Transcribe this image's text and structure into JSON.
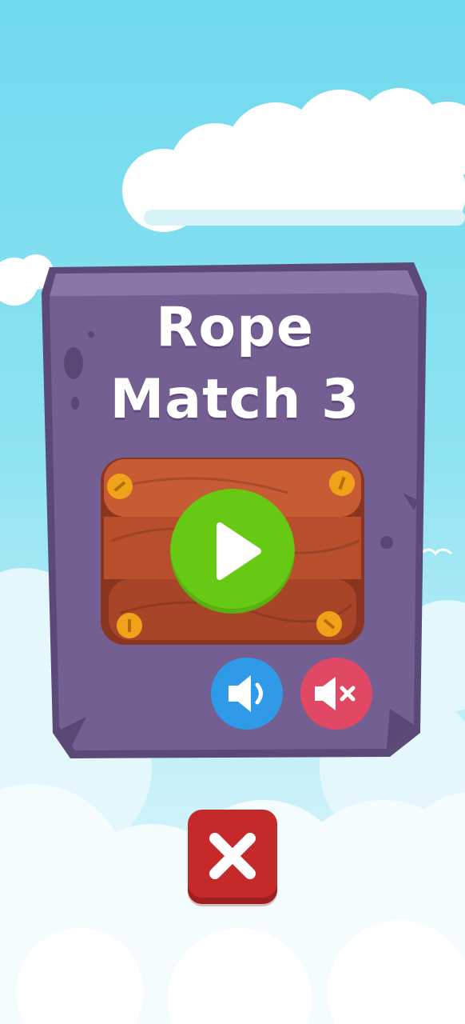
{
  "game": {
    "title_line1": "Rope",
    "title_line2": "Match 3"
  },
  "colors": {
    "sky": "#6fd9ee",
    "stone": "#735f8f",
    "wood": "#b44e2f",
    "play": "#66c914",
    "sound_on": "#2f9be8",
    "sound_off": "#e04864",
    "close": "#c42a2a"
  },
  "controls": {
    "play_icon": "play-icon",
    "sound_on_icon": "speaker-icon",
    "sound_off_icon": "speaker-mute-icon",
    "close_icon": "close-icon"
  }
}
